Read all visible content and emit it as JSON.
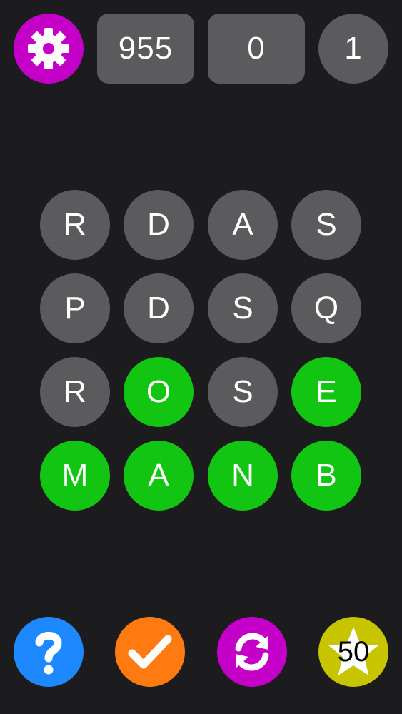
{
  "header": {
    "settings_icon": "gear-icon",
    "score": "955",
    "found_words": "0",
    "level": "1"
  },
  "board": {
    "rows": [
      [
        {
          "letter": "R",
          "state": "idle"
        },
        {
          "letter": "D",
          "state": "idle"
        },
        {
          "letter": "A",
          "state": "idle"
        },
        {
          "letter": "S",
          "state": "idle"
        }
      ],
      [
        {
          "letter": "P",
          "state": "idle"
        },
        {
          "letter": "D",
          "state": "idle"
        },
        {
          "letter": "S",
          "state": "idle"
        },
        {
          "letter": "Q",
          "state": "idle"
        }
      ],
      [
        {
          "letter": "R",
          "state": "idle"
        },
        {
          "letter": "O",
          "state": "selected"
        },
        {
          "letter": "S",
          "state": "idle"
        },
        {
          "letter": "E",
          "state": "selected"
        }
      ],
      [
        {
          "letter": "M",
          "state": "selected"
        },
        {
          "letter": "A",
          "state": "selected"
        },
        {
          "letter": "N",
          "state": "selected"
        },
        {
          "letter": "B",
          "state": "selected"
        }
      ]
    ]
  },
  "footer": {
    "help_icon": "question-mark-icon",
    "submit_icon": "checkmark-icon",
    "shuffle_icon": "refresh-icon",
    "bonus_icon": "star-icon",
    "bonus_count": "50"
  },
  "colors": {
    "background": "#1c1c1e",
    "tile_idle": "#5b5b5e",
    "tile_selected": "#12c512",
    "settings": "#c400c8",
    "help": "#1e88ff",
    "submit": "#ff7b12",
    "shuffle": "#c400c8",
    "bonus": "#c7c400"
  }
}
